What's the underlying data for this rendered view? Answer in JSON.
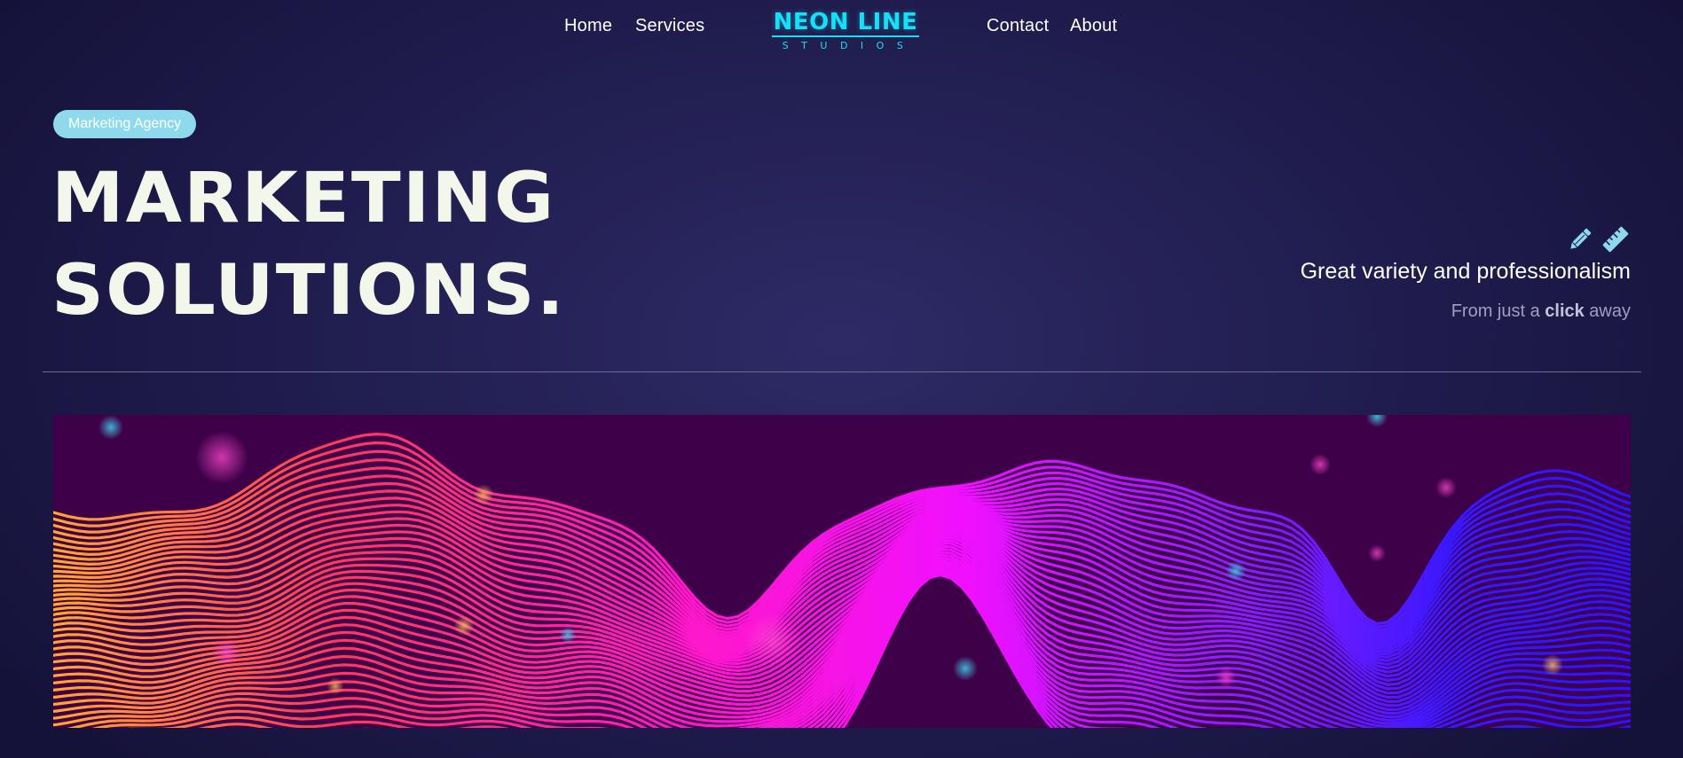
{
  "nav": {
    "links": [
      "Home",
      "Services",
      "Contact",
      "About"
    ]
  },
  "logo": {
    "main": "NEON LINE",
    "sub": "STUDIOS",
    "color": "#16e0f5"
  },
  "hero": {
    "badge": "Marketing Agency",
    "headline_line1": "MARKETING",
    "headline_line2": "SOLUTIONS.",
    "tagline": "Great variety and professionalism",
    "subline_pre": "From just a ",
    "subline_bold": "click",
    "subline_post": " away",
    "icons": [
      "pencil-icon",
      "ruler-icon"
    ]
  },
  "banner": {
    "description_colors": [
      "#ffa52a",
      "#ff2a6a",
      "#ff10e8",
      "#9a1cff",
      "#2a18ff"
    ]
  },
  "colors": {
    "background": "#221f52",
    "accent": "#16e0f5",
    "badge": "#8fd9ec",
    "headline": "#f3f6ea"
  }
}
